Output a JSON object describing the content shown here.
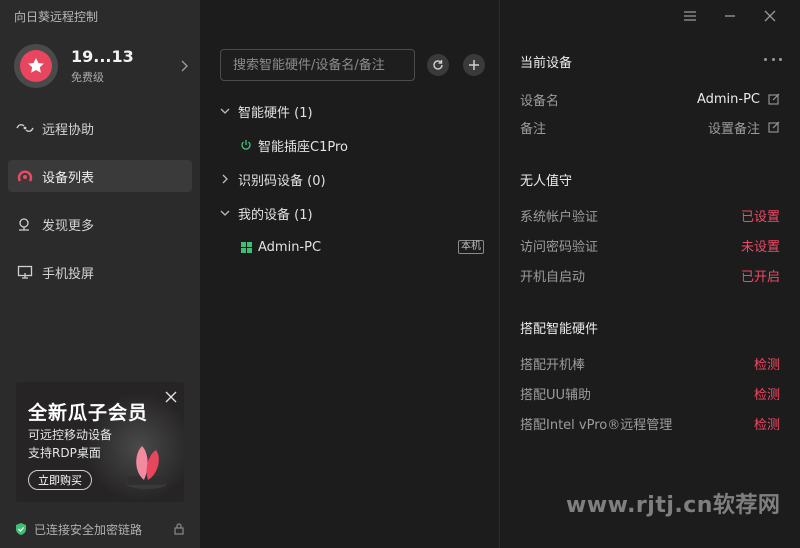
{
  "app": {
    "title": "向日葵远程控制"
  },
  "profile": {
    "name": "19...13",
    "level": "免费级"
  },
  "nav": {
    "items": [
      {
        "label": "远程协助",
        "icon": "remote-assist-icon",
        "active": false
      },
      {
        "label": "设备列表",
        "icon": "device-list-icon",
        "active": true
      },
      {
        "label": "发现更多",
        "icon": "discover-icon",
        "active": false
      },
      {
        "label": "手机投屏",
        "icon": "screen-cast-icon",
        "active": false
      }
    ]
  },
  "promo": {
    "title": "全新瓜子会员",
    "line1": "可远控移动设备",
    "line2": "支持RDP桌面",
    "button": "立即购买"
  },
  "status": {
    "text": "已连接安全加密链路"
  },
  "search": {
    "placeholder": "搜索智能硬件/设备名/备注"
  },
  "tree": {
    "groups": [
      {
        "label": "智能硬件 (1)",
        "expanded": true,
        "items": [
          {
            "label": "智能插座C1Pro",
            "icon": "power-icon",
            "badge": ""
          }
        ]
      },
      {
        "label": "识别码设备 (0)",
        "expanded": false,
        "items": []
      },
      {
        "label": "我的设备 (1)",
        "expanded": true,
        "items": [
          {
            "label": "Admin-PC",
            "icon": "windows-icon",
            "badge": "本机"
          }
        ]
      }
    ]
  },
  "details": {
    "current": {
      "title": "当前设备",
      "device_name_label": "设备名",
      "device_name_value": "Admin-PC",
      "remark_label": "备注",
      "remark_value": "设置备注"
    },
    "unattended": {
      "title": "无人值守",
      "rows": [
        {
          "label": "系统帐户验证",
          "value": "已设置"
        },
        {
          "label": "访问密码验证",
          "value": "未设置"
        },
        {
          "label": "开机自启动",
          "value": "已开启"
        }
      ]
    },
    "hardware": {
      "title": "搭配智能硬件",
      "rows": [
        {
          "label": "搭配开机棒",
          "value": "检测"
        },
        {
          "label": "搭配UU辅助",
          "value": "检测"
        },
        {
          "label": "搭配Intel vPro®远程管理",
          "value": "检测"
        }
      ]
    }
  },
  "watermark": "www.rjtj.cn软荐网",
  "colors": {
    "accent": "#ee4a63",
    "sidebar": "#2b2b2b",
    "panel": "#1c1c1c",
    "power_green": "#4cc07a",
    "windows_green": "#3fbf74"
  }
}
